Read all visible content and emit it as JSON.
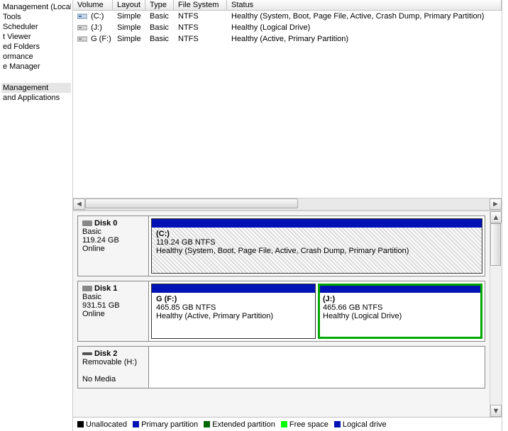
{
  "sidebar": {
    "items": [
      {
        "label": "Management (Local"
      },
      {
        "label": "Tools"
      },
      {
        "label": "Scheduler"
      },
      {
        "label": "t Viewer"
      },
      {
        "label": "ed Folders"
      },
      {
        "label": "ormance"
      },
      {
        "label": "e Manager"
      },
      {
        "label": "Management"
      },
      {
        "label": "and Applications"
      }
    ],
    "selected_index": 7,
    "spacer_after_index": 6
  },
  "volume_table": {
    "headers": {
      "volume": "Volume",
      "layout": "Layout",
      "type": "Type",
      "fs": "File System",
      "status": "Status"
    },
    "rows": [
      {
        "volume": "(C:)",
        "layout": "Simple",
        "type": "Basic",
        "fs": "NTFS",
        "status": "Healthy (System, Boot, Page File, Active, Crash Dump, Primary Partition)"
      },
      {
        "volume": "(J:)",
        "layout": "Simple",
        "type": "Basic",
        "fs": "NTFS",
        "status": "Healthy (Logical Drive)"
      },
      {
        "volume": "G (F:)",
        "layout": "Simple",
        "type": "Basic",
        "fs": "NTFS",
        "status": "Healthy (Active, Primary Partition)"
      }
    ]
  },
  "disks": [
    {
      "name": "Disk 0",
      "type": "Basic",
      "size": "119.24 GB",
      "status": "Online",
      "partitions": [
        {
          "label": "(C:)",
          "line2": "119.24 GB NTFS",
          "line3": "Healthy (System, Boot, Page File, Active, Crash Dump, Primary Partition)",
          "hatched": true,
          "selected": false
        }
      ]
    },
    {
      "name": "Disk 1",
      "type": "Basic",
      "size": "931.51 GB",
      "status": "Online",
      "partitions": [
        {
          "label": "G  (F:)",
          "line2": "465.85 GB NTFS",
          "line3": "Healthy (Active, Primary Partition)",
          "hatched": false,
          "selected": false
        },
        {
          "label": "(J:)",
          "line2": "465.66 GB NTFS",
          "line3": "Healthy (Logical Drive)",
          "hatched": false,
          "selected": true
        }
      ]
    },
    {
      "name": "Disk 2",
      "type": "Removable (H:)",
      "size": "",
      "status": "No Media",
      "compact": true,
      "partitions": []
    }
  ],
  "legend": {
    "unallocated": "Unallocated",
    "primary": "Primary partition",
    "extended": "Extended partition",
    "free": "Free space",
    "logical": "Logical drive"
  },
  "icons": {
    "drive_color": "#6ea9d9"
  }
}
